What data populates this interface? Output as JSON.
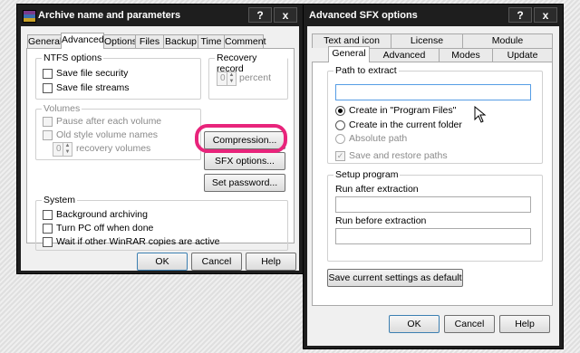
{
  "archive_dialog": {
    "title": "Archive name and parameters",
    "help_btn": "?",
    "close_btn": "x",
    "tabs": [
      "General",
      "Advanced",
      "Options",
      "Files",
      "Backup",
      "Time",
      "Comment"
    ],
    "ntfs": {
      "label": "NTFS options",
      "save_security": "Save file security",
      "save_streams": "Save file streams"
    },
    "recovery": {
      "label": "Recovery record",
      "value": "0",
      "unit": "percent"
    },
    "volumes": {
      "label": "Volumes",
      "pause": "Pause after each volume",
      "old_style": "Old style volume names",
      "recovery_value": "0",
      "recovery_label": "recovery volumes"
    },
    "buttons": {
      "compression": "Compression...",
      "sfx": "SFX options...",
      "password": "Set password..."
    },
    "system": {
      "label": "System",
      "background": "Background archiving",
      "turn_off": "Turn PC off when done",
      "wait": "Wait if other WinRAR copies are active"
    },
    "footer": {
      "ok": "OK",
      "cancel": "Cancel",
      "help": "Help"
    }
  },
  "sfx_dialog": {
    "title": "Advanced SFX options",
    "help_btn": "?",
    "close_btn": "x",
    "tabs_back": [
      "Text and icon",
      "License",
      "Module"
    ],
    "tabs_front": [
      "General",
      "Advanced",
      "Modes",
      "Update"
    ],
    "path": {
      "label": "Path to extract",
      "value": "",
      "opt_program_files": "Create in \"Program Files\"",
      "opt_current": "Create in the current folder",
      "opt_absolute": "Absolute path",
      "save_restore": "Save and restore paths"
    },
    "setup": {
      "label": "Setup program",
      "run_after": "Run after extraction",
      "run_after_value": "",
      "run_before": "Run before extraction",
      "run_before_value": ""
    },
    "save_default": "Save current settings as default",
    "footer": {
      "ok": "OK",
      "cancel": "Cancel",
      "help": "Help"
    }
  },
  "colors": {
    "title_bar": "#1e1e1e",
    "dialog_bg": "#f0f0f0",
    "highlight": "#e8247b",
    "focus": "#569de5"
  }
}
